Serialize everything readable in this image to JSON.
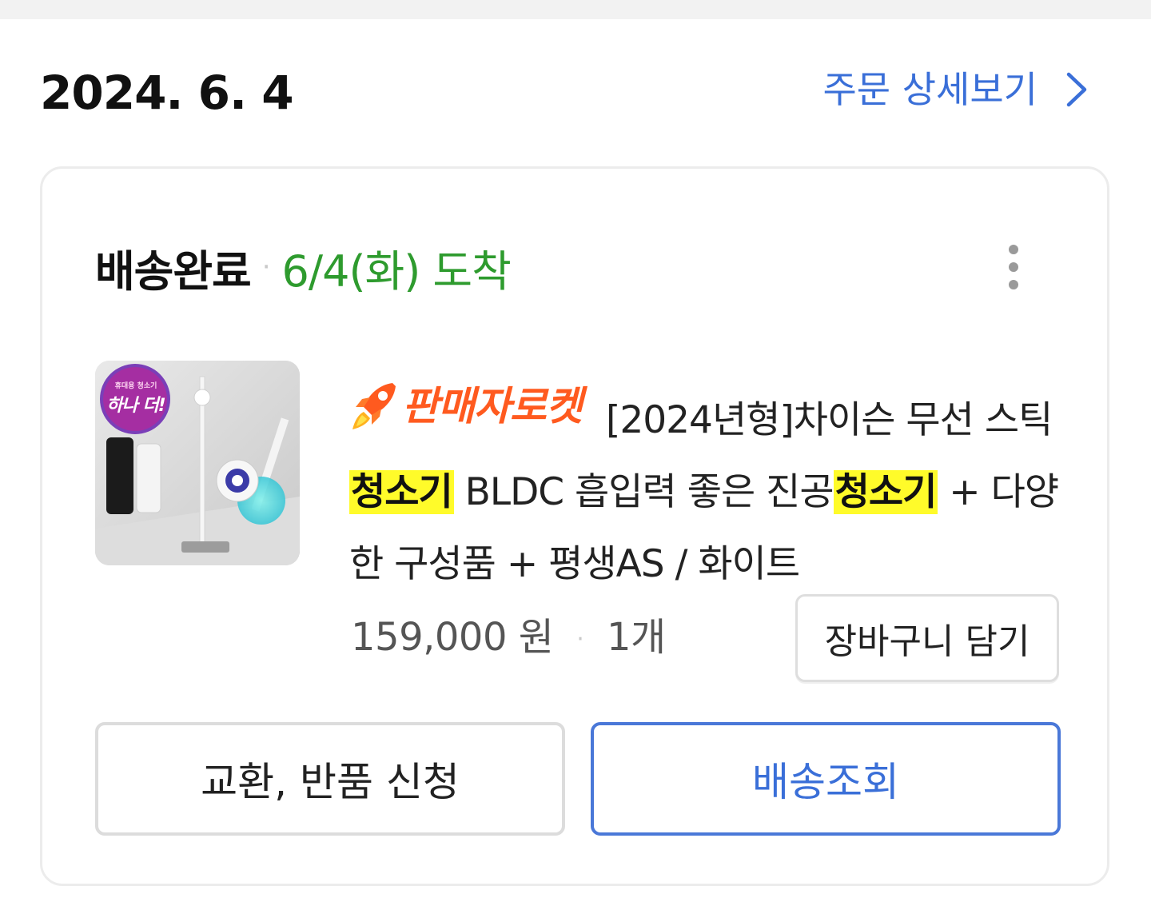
{
  "order": {
    "date": "2024. 6. 4",
    "detail_link_label": "주문 상세보기"
  },
  "card": {
    "status": "배송완료",
    "separator": "·",
    "arrival": "6/4(화) 도착",
    "product": {
      "badge_label": "판매자로켓",
      "thumbnail_label_top": "휴대용 청소기",
      "thumbnail_label_main": "하나 더!",
      "title_part1": "[2024년형]차이슨 무선 스틱 ",
      "highlight1": "청소기",
      "title_part2": " BLDC 흡입력 좋은 진공",
      "highlight2": "청소기",
      "title_part3": " + 다양한 구성품 + 평생AS / 화이트",
      "price": "159,000 원",
      "quantity": "1개"
    },
    "cart_button_label": "장바구니 담기",
    "return_button_label": "교환, 반품 신청",
    "track_button_label": "배송조회"
  },
  "colors": {
    "accent_blue": "#3a6fd8",
    "arrival_green": "#2e9b2e",
    "rocket_orange": "#ff5a1f",
    "highlight_yellow": "#fffb2a"
  },
  "icons": {
    "detail_chevron": "chevron-right-icon",
    "more_menu": "kebab-menu-icon",
    "rocket": "rocket-icon"
  }
}
